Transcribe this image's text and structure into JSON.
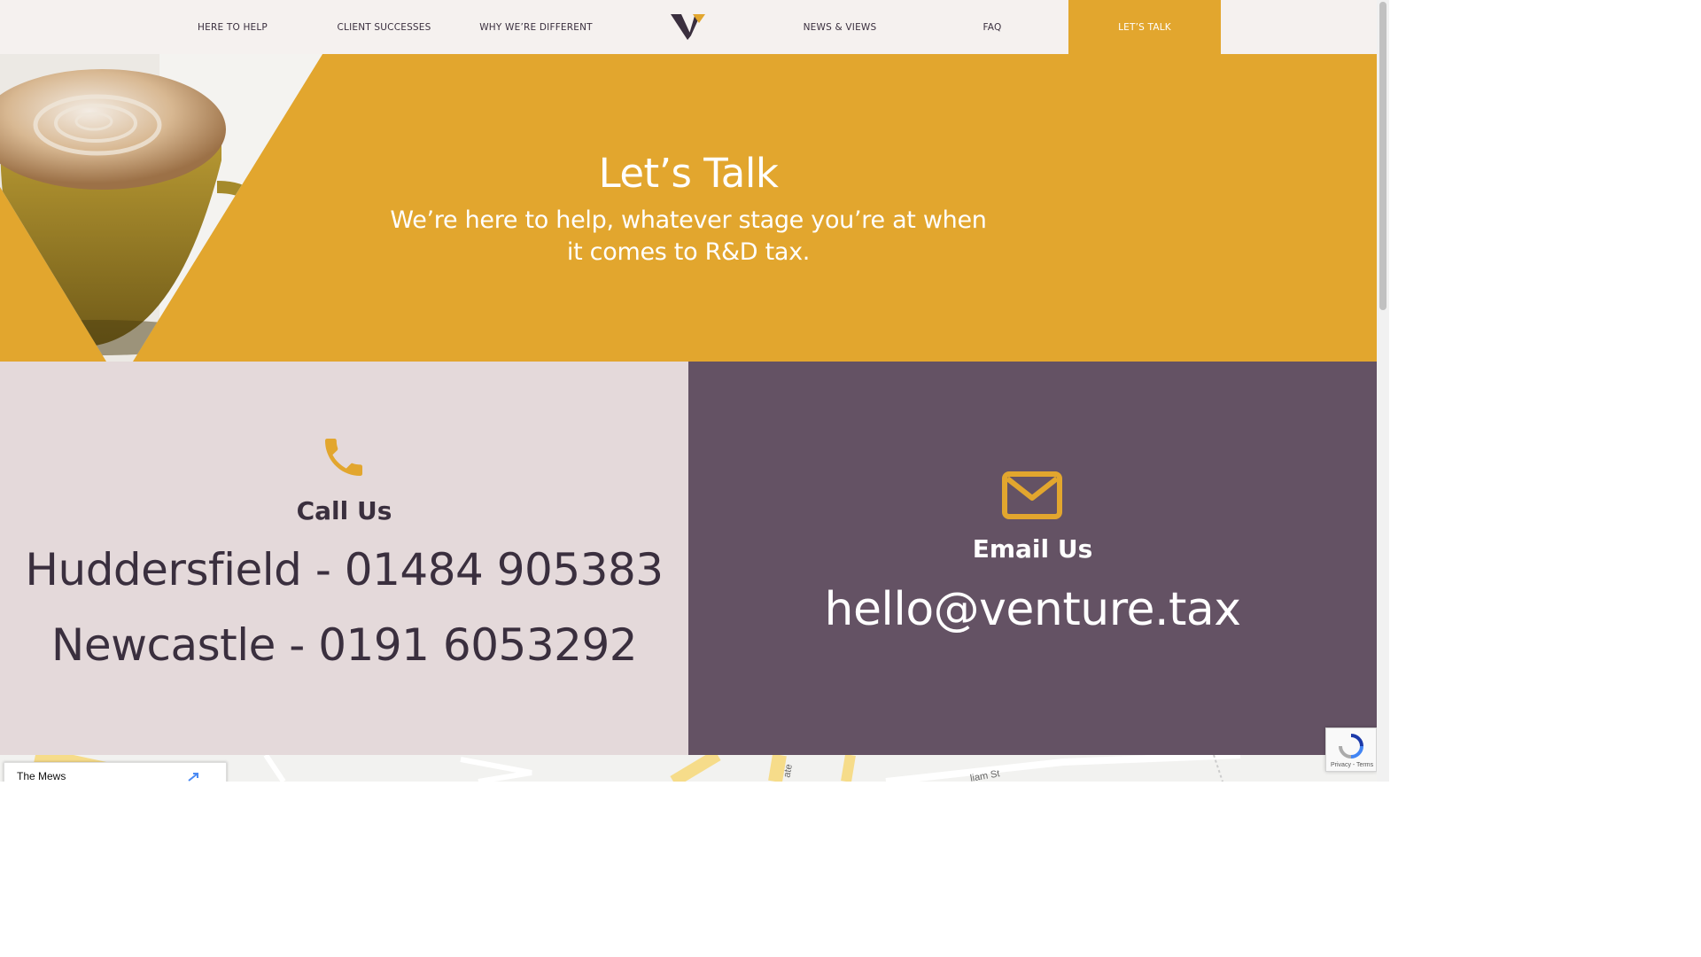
{
  "nav": {
    "items": [
      {
        "label": "HERE TO HELP"
      },
      {
        "label": "CLIENT SUCCESSES"
      },
      {
        "label": "WHY WE’RE DIFFERENT"
      },
      {
        "label": "NEWS & VIEWS"
      },
      {
        "label": "FAQ"
      },
      {
        "label": "LET’S TALK",
        "active": true
      }
    ],
    "logo_icon": "venture-v-logo-icon"
  },
  "hero": {
    "title": "Let’s Talk",
    "subtitle": "We’re here to help, whatever stage you’re at when it comes to R&D tax."
  },
  "call": {
    "icon": "phone-icon",
    "heading": "Call Us",
    "lines": [
      "Huddersfield - 01484 905383",
      "Newcastle - 0191 6053292"
    ]
  },
  "email": {
    "icon": "mail-icon",
    "heading": "Email Us",
    "address": "hello@venture.tax"
  },
  "map": {
    "card_title": "The Mews",
    "street_label": "liam St",
    "side_label": "ate"
  },
  "recaptcha": {
    "text": "Privacy - Terms"
  },
  "colors": {
    "accent": "#e2a62e",
    "plum": "#645264",
    "pink": "#e4d9da",
    "dark": "#3a2f3e",
    "nav_bg": "#f5f1ef"
  }
}
